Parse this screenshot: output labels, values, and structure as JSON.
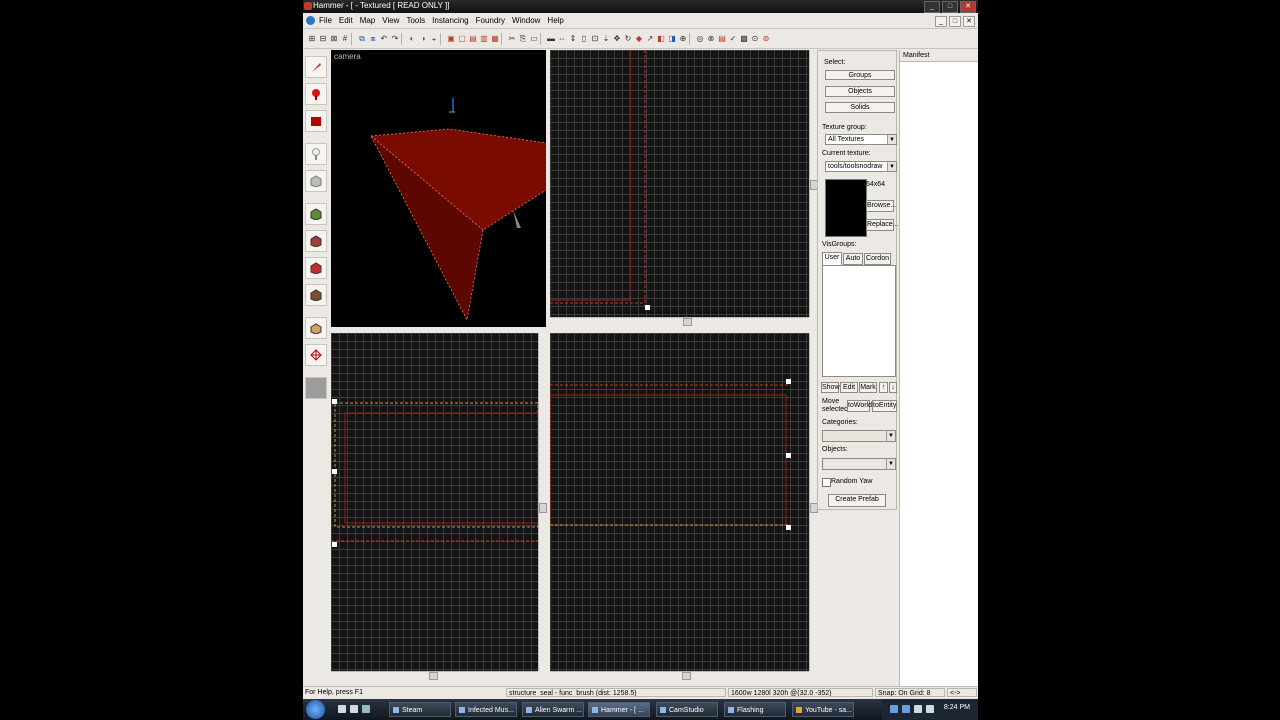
{
  "window": {
    "title": "Hammer - [ - Textured [ READ ONLY ]]",
    "controls": [
      "_",
      "□",
      "✕"
    ]
  },
  "menu": [
    "File",
    "Edit",
    "Map",
    "View",
    "Tools",
    "Instancing",
    "Foundry",
    "Window",
    "Help"
  ],
  "viewports": {
    "camera_label": "camera"
  },
  "panel": {
    "select_label": "Select:",
    "groups": "Groups",
    "objects": "Objects",
    "solids": "Solids",
    "texture_group_label": "Texture group:",
    "texture_group_value": "All Textures",
    "current_texture_label": "Current texture:",
    "current_texture_value": "tools/toolsnodraw",
    "texture_size": "64x64",
    "browse": "Browse...",
    "replace": "Replace...",
    "visgroups_label": "VisGroups:",
    "tabs": [
      "User",
      "Auto",
      "Cordon"
    ],
    "show": "Show",
    "edit": "Edit",
    "mark": "Mark",
    "up": "↑",
    "down": "↓",
    "move_selected": "Move selected:",
    "to_world": "toWorld",
    "to_entity": "toEntity",
    "categories_label": "Categories:",
    "objects_label": "Objects:",
    "random_yaw": "Random Yaw",
    "create_prefab": "Create Prefab"
  },
  "manifest": {
    "title": "Manifest"
  },
  "status": {
    "help": "For Help, press F1",
    "selection": "structure_seal - func_brush  (dist: 1258.5)",
    "size": "1600w 1280l 320h @(32.0 -352)",
    "snap": "Snap: On Grid: 8",
    "extra": "<->"
  },
  "taskbar": {
    "tasks": [
      "Steam",
      "Infected Mus...",
      "Alien Swarm ...",
      "Hammer - [ ...",
      "CamStudio",
      "Flashing",
      "YouTube - sa..."
    ],
    "clock": "8:24 PM"
  },
  "colors": {
    "brush": "#7a0b00",
    "selection": "#ff2a1a",
    "grid": "#3b3b3b",
    "accent": "#c0392b"
  }
}
